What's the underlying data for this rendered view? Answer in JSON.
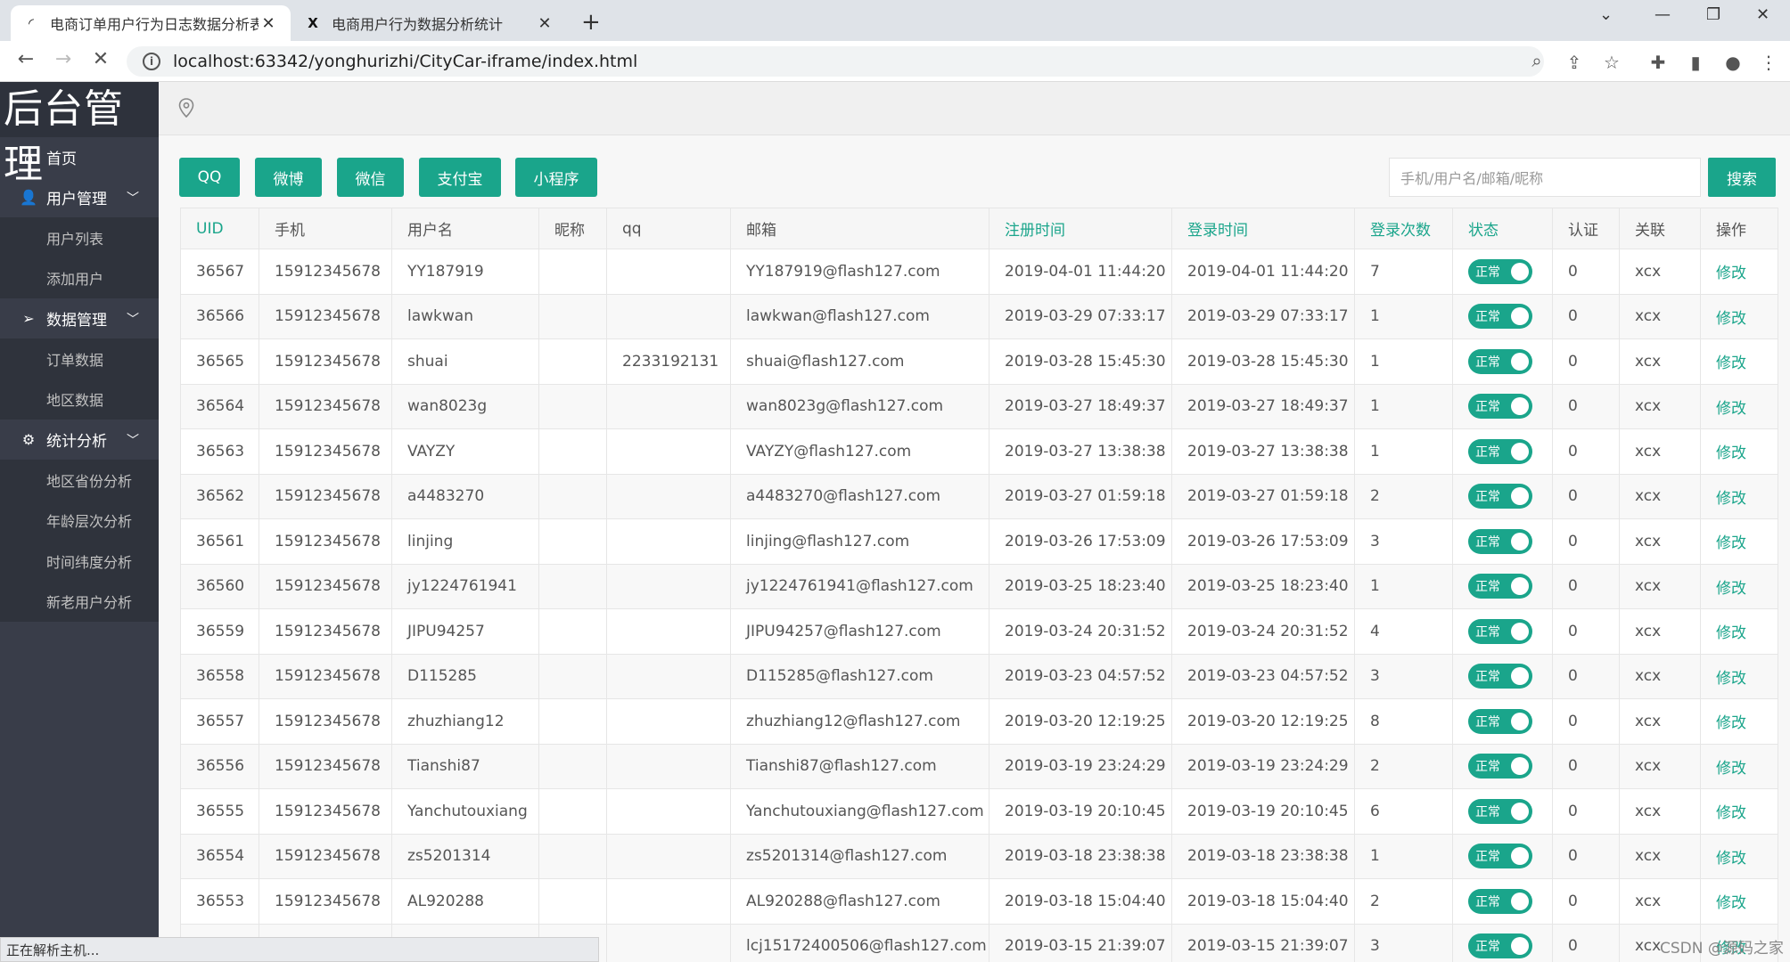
{
  "browser": {
    "tabs": [
      {
        "title": "电商订单用户行为日志数据分析表",
        "close": "✕"
      },
      {
        "title": "电商用户行为数据分析统计",
        "close": "✕"
      }
    ],
    "new_tab": "+",
    "url": "localhost:63342/yonghurizhi/CityCar-iframe/index.html",
    "status": "正在解析主机..."
  },
  "sidebar": {
    "brand": "后台管理",
    "home": "首页",
    "groups": [
      {
        "label": "用户管理",
        "items": [
          "用户列表",
          "添加用户"
        ]
      },
      {
        "label": "数据管理",
        "items": [
          "订单数据",
          "地区数据"
        ]
      },
      {
        "label": "统计分析",
        "items": [
          "地区省份分析",
          "年龄层次分析",
          "时间纬度分析",
          "新老用户分析"
        ]
      }
    ]
  },
  "filters": {
    "buttons": [
      "QQ",
      "微博",
      "微信",
      "支付宝",
      "小程序"
    ],
    "search_placeholder": "手机/用户名/邮箱/昵称",
    "search_label": "搜索"
  },
  "table": {
    "headers": [
      "UID",
      "手机",
      "用户名",
      "昵称",
      "qq",
      "邮箱",
      "注册时间",
      "登录时间",
      "登录次数",
      "状态",
      "认证",
      "关联",
      "操作"
    ],
    "status_label": "正常",
    "edit_label": "修改",
    "rows": [
      [
        "36567",
        "15912345678",
        "YY187919",
        "",
        "",
        "YY187919@flash127.com",
        "2019-04-01 11:44:20",
        "2019-04-01 11:44:20",
        "7",
        "0",
        "xcx"
      ],
      [
        "36566",
        "15912345678",
        "lawkwan",
        "",
        "",
        "lawkwan@flash127.com",
        "2019-03-29 07:33:17",
        "2019-03-29 07:33:17",
        "1",
        "0",
        "xcx"
      ],
      [
        "36565",
        "15912345678",
        "shuai",
        "",
        "2233192131",
        "shuai@flash127.com",
        "2019-03-28 15:45:30",
        "2019-03-28 15:45:30",
        "1",
        "0",
        "xcx"
      ],
      [
        "36564",
        "15912345678",
        "wan8023g",
        "",
        "",
        "wan8023g@flash127.com",
        "2019-03-27 18:49:37",
        "2019-03-27 18:49:37",
        "1",
        "0",
        "xcx"
      ],
      [
        "36563",
        "15912345678",
        "VAYZY",
        "",
        "",
        "VAYZY@flash127.com",
        "2019-03-27 13:38:38",
        "2019-03-27 13:38:38",
        "1",
        "0",
        "xcx"
      ],
      [
        "36562",
        "15912345678",
        "a4483270",
        "",
        "",
        "a4483270@flash127.com",
        "2019-03-27 01:59:18",
        "2019-03-27 01:59:18",
        "2",
        "0",
        "xcx"
      ],
      [
        "36561",
        "15912345678",
        "linjing",
        "",
        "",
        "linjing@flash127.com",
        "2019-03-26 17:53:09",
        "2019-03-26 17:53:09",
        "3",
        "0",
        "xcx"
      ],
      [
        "36560",
        "15912345678",
        "jy1224761941",
        "",
        "",
        "jy1224761941@flash127.com",
        "2019-03-25 18:23:40",
        "2019-03-25 18:23:40",
        "1",
        "0",
        "xcx"
      ],
      [
        "36559",
        "15912345678",
        "JIPU94257",
        "",
        "",
        "JIPU94257@flash127.com",
        "2019-03-24 20:31:52",
        "2019-03-24 20:31:52",
        "4",
        "0",
        "xcx"
      ],
      [
        "36558",
        "15912345678",
        "D115285",
        "",
        "",
        "D115285@flash127.com",
        "2019-03-23 04:57:52",
        "2019-03-23 04:57:52",
        "3",
        "0",
        "xcx"
      ],
      [
        "36557",
        "15912345678",
        "zhuzhiang12",
        "",
        "",
        "zhuzhiang12@flash127.com",
        "2019-03-20 12:19:25",
        "2019-03-20 12:19:25",
        "8",
        "0",
        "xcx"
      ],
      [
        "36556",
        "15912345678",
        "Tianshi87",
        "",
        "",
        "Tianshi87@flash127.com",
        "2019-03-19 23:24:29",
        "2019-03-19 23:24:29",
        "2",
        "0",
        "xcx"
      ],
      [
        "36555",
        "15912345678",
        "Yanchutouxiang",
        "",
        "",
        "Yanchutouxiang@flash127.com",
        "2019-03-19 20:10:45",
        "2019-03-19 20:10:45",
        "6",
        "0",
        "xcx"
      ],
      [
        "36554",
        "15912345678",
        "zs5201314",
        "",
        "",
        "zs5201314@flash127.com",
        "2019-03-18 23:38:38",
        "2019-03-18 23:38:38",
        "1",
        "0",
        "xcx"
      ],
      [
        "36553",
        "15912345678",
        "AL920288",
        "",
        "",
        "AL920288@flash127.com",
        "2019-03-18 15:04:40",
        "2019-03-18 15:04:40",
        "2",
        "0",
        "xcx"
      ],
      [
        "",
        "",
        "",
        "",
        "",
        "lcj15172400506@flash127.com",
        "2019-03-15 21:39:07",
        "2019-03-15 21:39:07",
        "3",
        "0",
        "xcx"
      ]
    ]
  },
  "watermark": "CSDN @源码之家",
  "colors": {
    "accent": "#1aa58b",
    "sidebar": "#393d49"
  }
}
